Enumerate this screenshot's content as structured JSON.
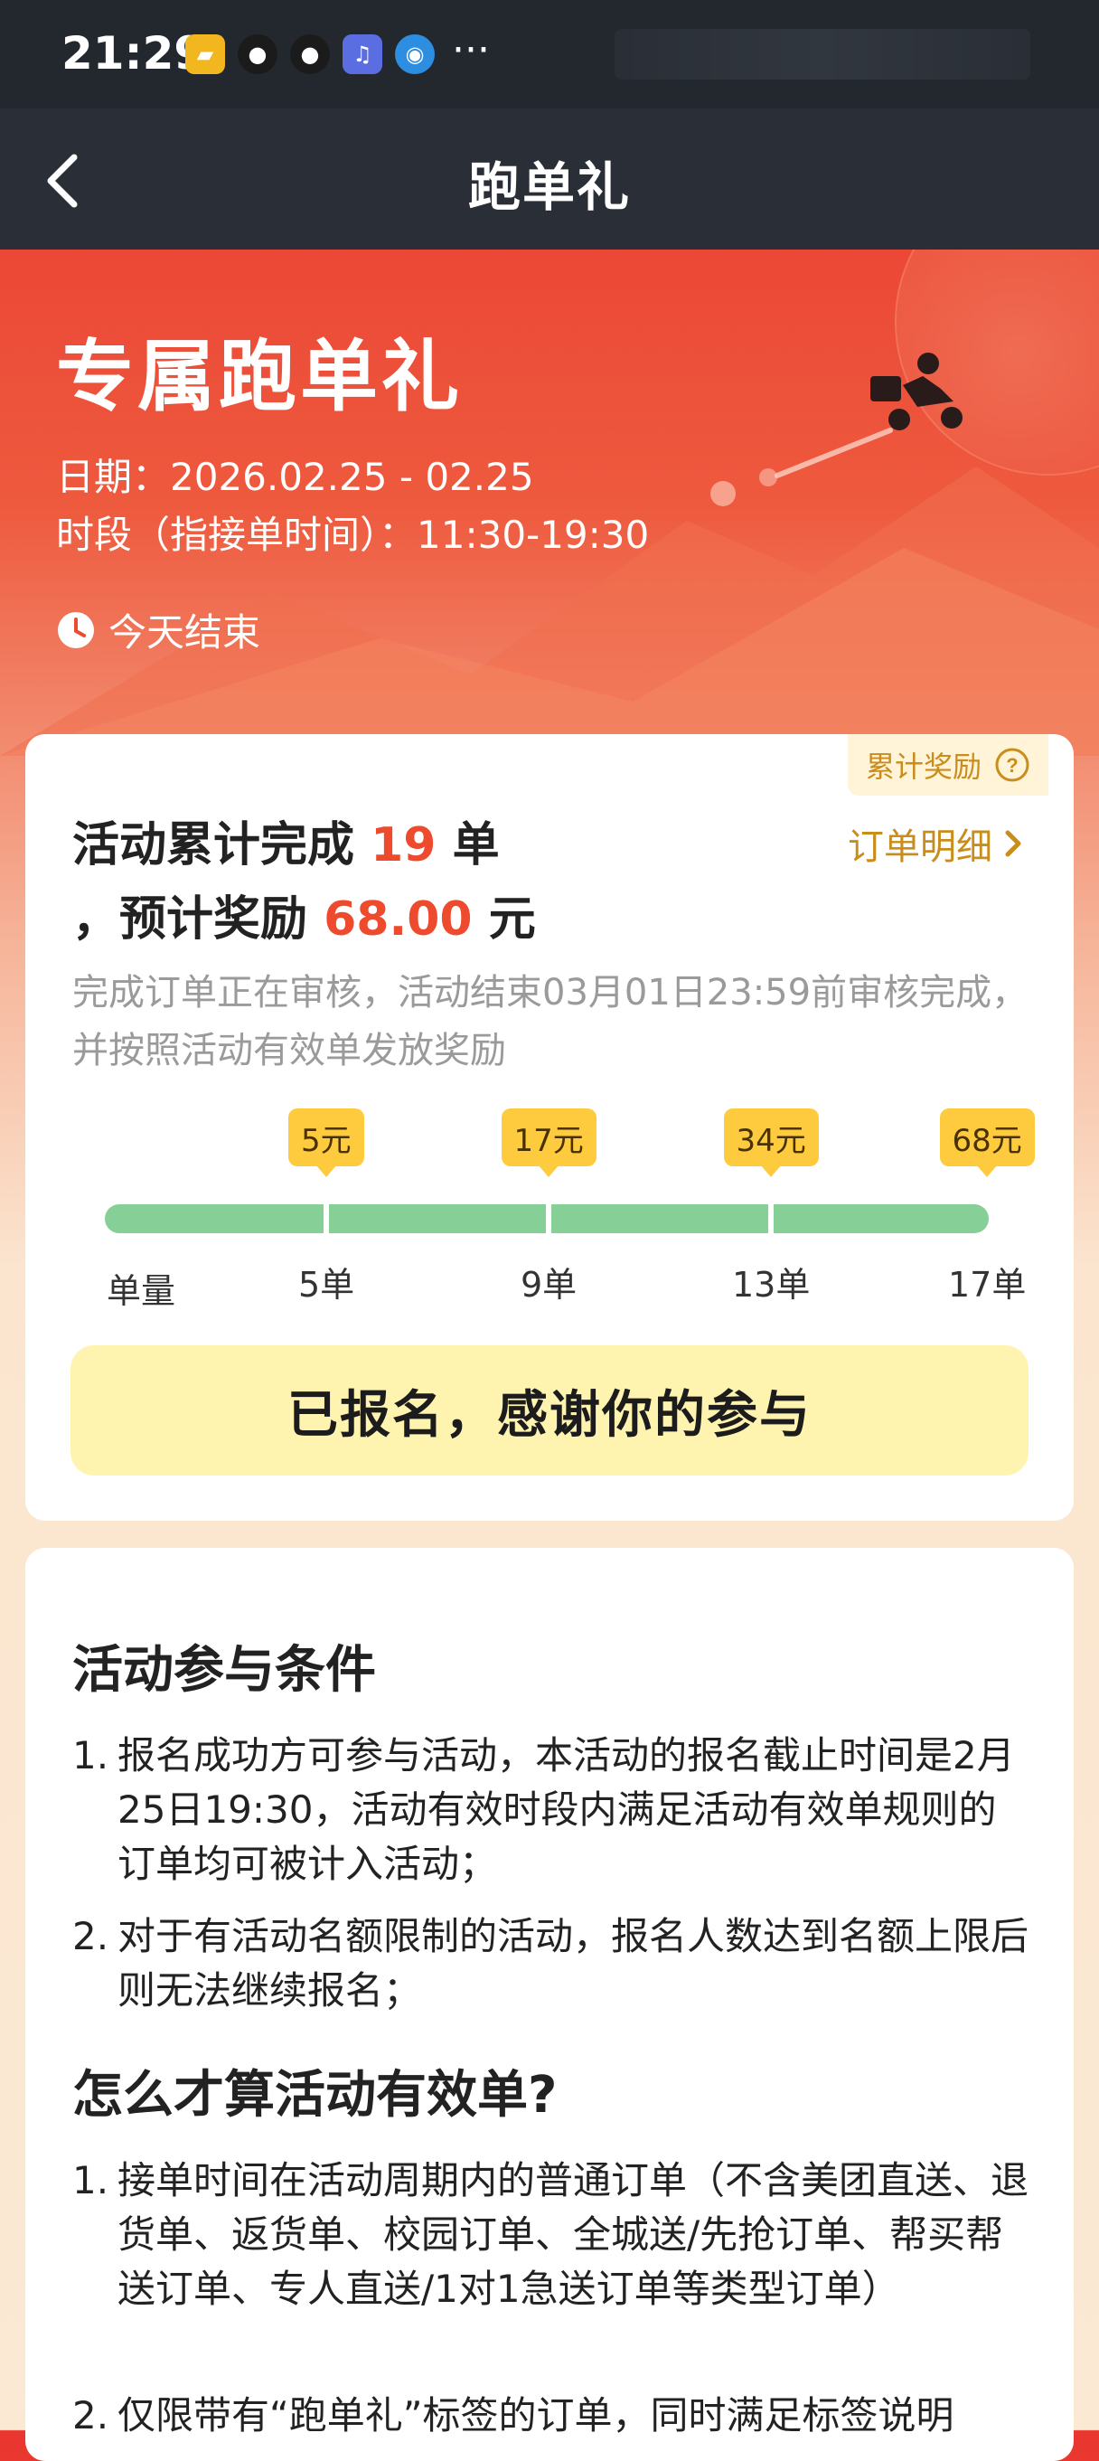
{
  "status_bar": {
    "time": "21:29",
    "more": "···"
  },
  "nav": {
    "title": "跑单礼"
  },
  "hero": {
    "title": "专属跑单礼",
    "date": "日期：2026.02.25 - 02.25",
    "period": "时段（指接单时间）：11:30-19:30",
    "ends": "今天结束"
  },
  "summary": {
    "reward_tag": "累计奖励",
    "line1_prefix": "活动累计完成",
    "count": "19",
    "line1_suffix": "单",
    "line2_prefix": "，预计奖励",
    "amount": "68.00",
    "line2_suffix": "元",
    "order_detail": "订单明细",
    "note": "完成订单正在审核，活动结束03月01日23:59前审核完成，并按照活动有效单发放奖励"
  },
  "progress": {
    "start_label": "单量",
    "tiers": [
      {
        "reward": "5元",
        "orders": "5单"
      },
      {
        "reward": "17元",
        "orders": "9单"
      },
      {
        "reward": "34元",
        "orders": "13单"
      },
      {
        "reward": "68元",
        "orders": "17单"
      }
    ],
    "completion": 1.0
  },
  "signed_button": "已报名，感谢你的参与",
  "conditions": {
    "title": "活动参与条件",
    "items": [
      "报名成功方可参与活动，本活动的报名截止时间是2月25日19:30，活动有效时段内满足活动有效单规则的订单均可被计入活动；",
      "对于有活动名额限制的活动，报名人数达到名额上限后则无法继续报名；"
    ]
  },
  "valid_orders": {
    "title": "怎么才算活动有效单?",
    "items": [
      "接单时间在活动周期内的普通订单（不含美团直送、退货单、返货单、校园订单、全城送/先抢订单、帮买帮送订单、专人直送/1对1急送订单等类型订单）",
      "仅限带有“跑单礼”标签的订单，同时满足标签说明"
    ]
  },
  "colors": {
    "accent_red": "#ee4a2e",
    "gold": "#c98d1b",
    "progress_green": "#86cf96",
    "bubble_yellow": "#fecb3e"
  }
}
